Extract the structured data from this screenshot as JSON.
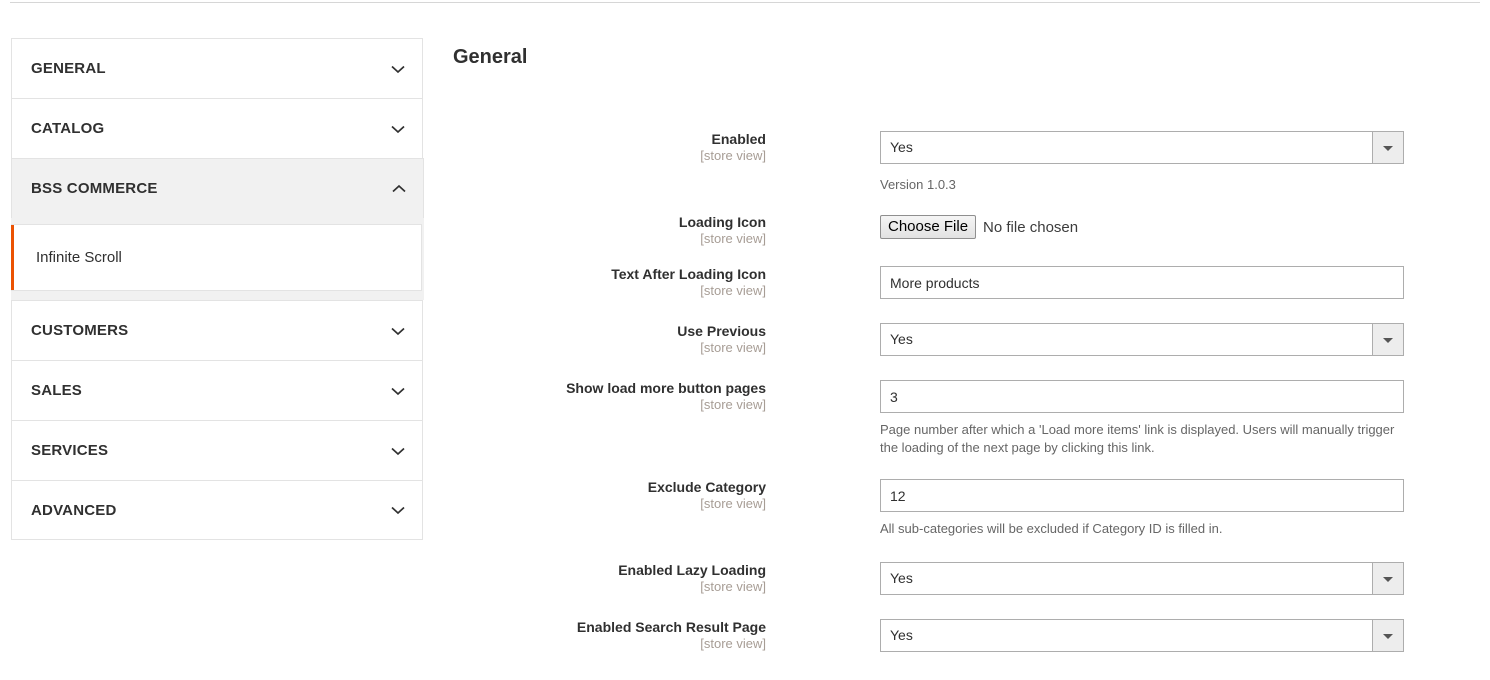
{
  "sidebar": {
    "items": [
      {
        "label": "GENERAL",
        "icon": "chevron-down-icon",
        "expanded": false
      },
      {
        "label": "CATALOG",
        "icon": "chevron-down-icon",
        "expanded": false
      },
      {
        "label": "BSS COMMERCE",
        "icon": "chevron-up-icon",
        "expanded": true
      },
      {
        "label": "CUSTOMERS",
        "icon": "chevron-down-icon",
        "expanded": false
      },
      {
        "label": "SALES",
        "icon": "chevron-down-icon",
        "expanded": false
      },
      {
        "label": "SERVICES",
        "icon": "chevron-down-icon",
        "expanded": false
      },
      {
        "label": "ADVANCED",
        "icon": "chevron-down-icon",
        "expanded": false
      }
    ],
    "active_child": "Infinite Scroll",
    "accent_color": "#eb5202"
  },
  "main": {
    "title": "General",
    "scope_label": "[store view]",
    "fields": {
      "enabled": {
        "label": "Enabled",
        "scope": "[store view]",
        "value": "Yes",
        "note": "Version 1.0.3"
      },
      "loading_icon": {
        "label": "Loading Icon",
        "scope": "[store view]",
        "button_label": "Choose File",
        "file_status": "No file chosen"
      },
      "text_after_loading_icon": {
        "label": "Text After Loading Icon",
        "scope": "[store view]",
        "value": "More products"
      },
      "use_previous": {
        "label": "Use Previous",
        "scope": "[store view]",
        "value": "Yes"
      },
      "show_load_more_button_pages": {
        "label": "Show load more button pages",
        "scope": "[store view]",
        "value": "3",
        "note": "Page number after which a 'Load more items' link is displayed. Users will manually trigger the loading of the next page by clicking this link."
      },
      "exclude_category": {
        "label": "Exclude Category",
        "scope": "[store view]",
        "value": "12",
        "note": "All sub-categories will be excluded if Category ID is filled in."
      },
      "enabled_lazy_loading": {
        "label": "Enabled Lazy Loading",
        "scope": "[store view]",
        "value": "Yes"
      },
      "enabled_search_result_page": {
        "label": "Enabled Search Result Page",
        "scope": "[store view]",
        "value": "Yes"
      }
    }
  }
}
